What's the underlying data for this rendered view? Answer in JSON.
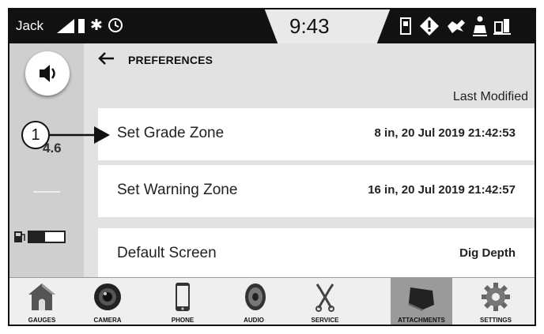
{
  "status_bar": {
    "operator": "Jack",
    "time": "9:43",
    "icons": [
      "signal-icon",
      "battery-icon",
      "bluetooth-icon",
      "clock-status-icon",
      "phone-status-icon",
      "warning-icon",
      "engine-icon",
      "seatbelt-icon",
      "calibration-icon"
    ]
  },
  "left_rail": {
    "speaker_icon": "speaker-icon",
    "depth_value": "4.6",
    "fuel_icon": "fuel-icon"
  },
  "header": {
    "title": "PREFERENCES",
    "back_icon": "back-arrow-icon"
  },
  "list": {
    "column_header": "Last Modified",
    "rows": [
      {
        "label": "Set Grade Zone",
        "value": "8 in, 20 Jul 2019 21:42:53"
      },
      {
        "label": "Set Warning Zone",
        "value": "16 in, 20 Jul 2019 21:42:57"
      },
      {
        "label": "Default Screen",
        "value": "Dig Depth"
      }
    ]
  },
  "callout": {
    "number": "1"
  },
  "nav": {
    "active": "ATTACHMENTS",
    "items": [
      {
        "label": "GAUGES",
        "icon": "home-icon"
      },
      {
        "label": "CAMERA",
        "icon": "camera-icon"
      },
      {
        "label": "PHONE",
        "icon": "phone-icon"
      },
      {
        "label": "AUDIO",
        "icon": "speaker-icon"
      },
      {
        "label": "SERVICE",
        "icon": "wrench-icon"
      },
      {
        "label": "ATTACHMENTS",
        "icon": "bucket-icon"
      },
      {
        "label": "SETTINGS",
        "icon": "gear-icon"
      }
    ]
  }
}
